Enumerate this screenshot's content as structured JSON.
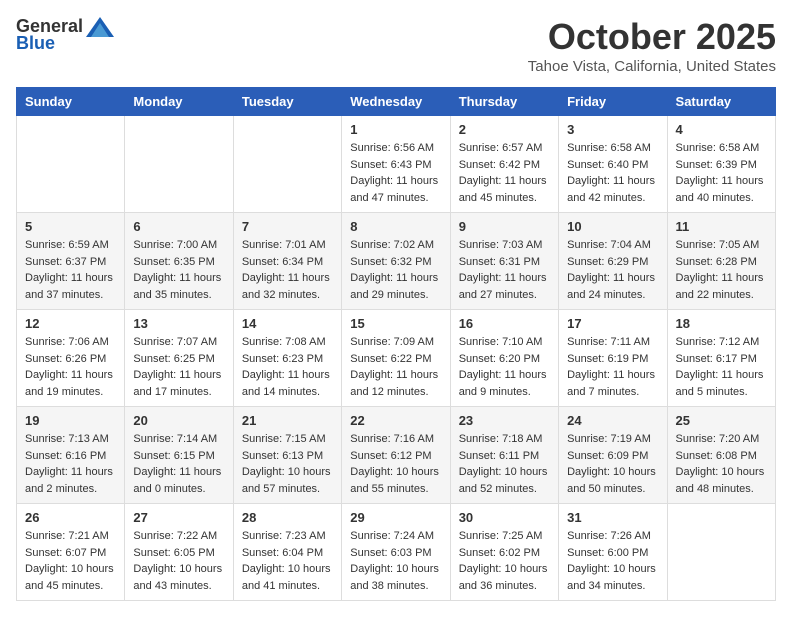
{
  "header": {
    "logo_general": "General",
    "logo_blue": "Blue",
    "month": "October 2025",
    "location": "Tahoe Vista, California, United States"
  },
  "weekdays": [
    "Sunday",
    "Monday",
    "Tuesday",
    "Wednesday",
    "Thursday",
    "Friday",
    "Saturday"
  ],
  "weeks": [
    [
      {
        "day": "",
        "sunrise": "",
        "sunset": "",
        "daylight": ""
      },
      {
        "day": "",
        "sunrise": "",
        "sunset": "",
        "daylight": ""
      },
      {
        "day": "",
        "sunrise": "",
        "sunset": "",
        "daylight": ""
      },
      {
        "day": "1",
        "sunrise": "Sunrise: 6:56 AM",
        "sunset": "Sunset: 6:43 PM",
        "daylight": "Daylight: 11 hours and 47 minutes."
      },
      {
        "day": "2",
        "sunrise": "Sunrise: 6:57 AM",
        "sunset": "Sunset: 6:42 PM",
        "daylight": "Daylight: 11 hours and 45 minutes."
      },
      {
        "day": "3",
        "sunrise": "Sunrise: 6:58 AM",
        "sunset": "Sunset: 6:40 PM",
        "daylight": "Daylight: 11 hours and 42 minutes."
      },
      {
        "day": "4",
        "sunrise": "Sunrise: 6:58 AM",
        "sunset": "Sunset: 6:39 PM",
        "daylight": "Daylight: 11 hours and 40 minutes."
      }
    ],
    [
      {
        "day": "5",
        "sunrise": "Sunrise: 6:59 AM",
        "sunset": "Sunset: 6:37 PM",
        "daylight": "Daylight: 11 hours and 37 minutes."
      },
      {
        "day": "6",
        "sunrise": "Sunrise: 7:00 AM",
        "sunset": "Sunset: 6:35 PM",
        "daylight": "Daylight: 11 hours and 35 minutes."
      },
      {
        "day": "7",
        "sunrise": "Sunrise: 7:01 AM",
        "sunset": "Sunset: 6:34 PM",
        "daylight": "Daylight: 11 hours and 32 minutes."
      },
      {
        "day": "8",
        "sunrise": "Sunrise: 7:02 AM",
        "sunset": "Sunset: 6:32 PM",
        "daylight": "Daylight: 11 hours and 29 minutes."
      },
      {
        "day": "9",
        "sunrise": "Sunrise: 7:03 AM",
        "sunset": "Sunset: 6:31 PM",
        "daylight": "Daylight: 11 hours and 27 minutes."
      },
      {
        "day": "10",
        "sunrise": "Sunrise: 7:04 AM",
        "sunset": "Sunset: 6:29 PM",
        "daylight": "Daylight: 11 hours and 24 minutes."
      },
      {
        "day": "11",
        "sunrise": "Sunrise: 7:05 AM",
        "sunset": "Sunset: 6:28 PM",
        "daylight": "Daylight: 11 hours and 22 minutes."
      }
    ],
    [
      {
        "day": "12",
        "sunrise": "Sunrise: 7:06 AM",
        "sunset": "Sunset: 6:26 PM",
        "daylight": "Daylight: 11 hours and 19 minutes."
      },
      {
        "day": "13",
        "sunrise": "Sunrise: 7:07 AM",
        "sunset": "Sunset: 6:25 PM",
        "daylight": "Daylight: 11 hours and 17 minutes."
      },
      {
        "day": "14",
        "sunrise": "Sunrise: 7:08 AM",
        "sunset": "Sunset: 6:23 PM",
        "daylight": "Daylight: 11 hours and 14 minutes."
      },
      {
        "day": "15",
        "sunrise": "Sunrise: 7:09 AM",
        "sunset": "Sunset: 6:22 PM",
        "daylight": "Daylight: 11 hours and 12 minutes."
      },
      {
        "day": "16",
        "sunrise": "Sunrise: 7:10 AM",
        "sunset": "Sunset: 6:20 PM",
        "daylight": "Daylight: 11 hours and 9 minutes."
      },
      {
        "day": "17",
        "sunrise": "Sunrise: 7:11 AM",
        "sunset": "Sunset: 6:19 PM",
        "daylight": "Daylight: 11 hours and 7 minutes."
      },
      {
        "day": "18",
        "sunrise": "Sunrise: 7:12 AM",
        "sunset": "Sunset: 6:17 PM",
        "daylight": "Daylight: 11 hours and 5 minutes."
      }
    ],
    [
      {
        "day": "19",
        "sunrise": "Sunrise: 7:13 AM",
        "sunset": "Sunset: 6:16 PM",
        "daylight": "Daylight: 11 hours and 2 minutes."
      },
      {
        "day": "20",
        "sunrise": "Sunrise: 7:14 AM",
        "sunset": "Sunset: 6:15 PM",
        "daylight": "Daylight: 11 hours and 0 minutes."
      },
      {
        "day": "21",
        "sunrise": "Sunrise: 7:15 AM",
        "sunset": "Sunset: 6:13 PM",
        "daylight": "Daylight: 10 hours and 57 minutes."
      },
      {
        "day": "22",
        "sunrise": "Sunrise: 7:16 AM",
        "sunset": "Sunset: 6:12 PM",
        "daylight": "Daylight: 10 hours and 55 minutes."
      },
      {
        "day": "23",
        "sunrise": "Sunrise: 7:18 AM",
        "sunset": "Sunset: 6:11 PM",
        "daylight": "Daylight: 10 hours and 52 minutes."
      },
      {
        "day": "24",
        "sunrise": "Sunrise: 7:19 AM",
        "sunset": "Sunset: 6:09 PM",
        "daylight": "Daylight: 10 hours and 50 minutes."
      },
      {
        "day": "25",
        "sunrise": "Sunrise: 7:20 AM",
        "sunset": "Sunset: 6:08 PM",
        "daylight": "Daylight: 10 hours and 48 minutes."
      }
    ],
    [
      {
        "day": "26",
        "sunrise": "Sunrise: 7:21 AM",
        "sunset": "Sunset: 6:07 PM",
        "daylight": "Daylight: 10 hours and 45 minutes."
      },
      {
        "day": "27",
        "sunrise": "Sunrise: 7:22 AM",
        "sunset": "Sunset: 6:05 PM",
        "daylight": "Daylight: 10 hours and 43 minutes."
      },
      {
        "day": "28",
        "sunrise": "Sunrise: 7:23 AM",
        "sunset": "Sunset: 6:04 PM",
        "daylight": "Daylight: 10 hours and 41 minutes."
      },
      {
        "day": "29",
        "sunrise": "Sunrise: 7:24 AM",
        "sunset": "Sunset: 6:03 PM",
        "daylight": "Daylight: 10 hours and 38 minutes."
      },
      {
        "day": "30",
        "sunrise": "Sunrise: 7:25 AM",
        "sunset": "Sunset: 6:02 PM",
        "daylight": "Daylight: 10 hours and 36 minutes."
      },
      {
        "day": "31",
        "sunrise": "Sunrise: 7:26 AM",
        "sunset": "Sunset: 6:00 PM",
        "daylight": "Daylight: 10 hours and 34 minutes."
      },
      {
        "day": "",
        "sunrise": "",
        "sunset": "",
        "daylight": ""
      }
    ]
  ]
}
